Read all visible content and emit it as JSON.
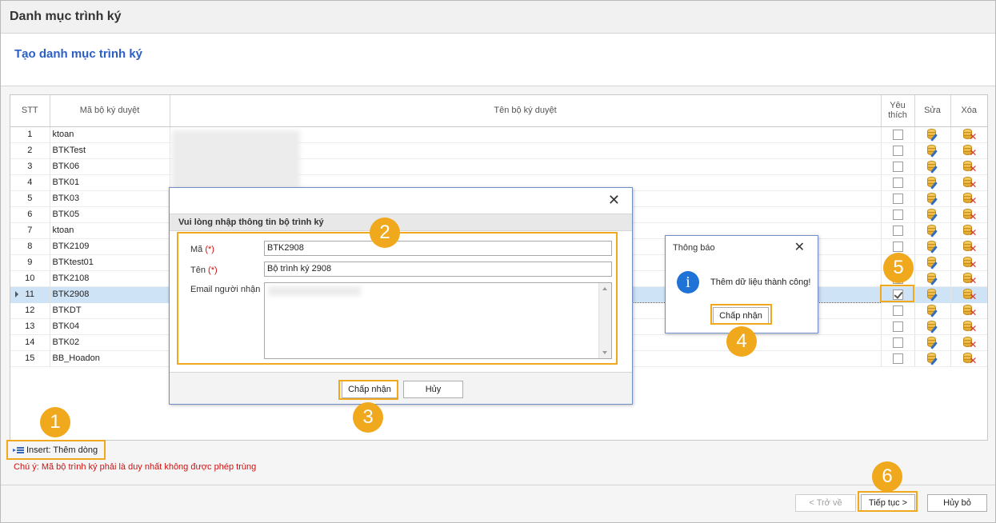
{
  "window": {
    "title": "Danh mục trình ký"
  },
  "section": {
    "subtitle": "Tạo danh mục trình ký"
  },
  "grid": {
    "headers": {
      "stt": "STT",
      "code": "Mã bộ ký duyệt",
      "name": "Tên bộ ký duyệt",
      "fav": "Yêu thích",
      "edit": "Sửa",
      "del": "Xóa"
    },
    "rows": [
      {
        "stt": "1",
        "code": "ktoan",
        "fav": false
      },
      {
        "stt": "2",
        "code": "BTKTest",
        "fav": false
      },
      {
        "stt": "3",
        "code": "BTK06",
        "fav": false
      },
      {
        "stt": "4",
        "code": "BTK01",
        "fav": false
      },
      {
        "stt": "5",
        "code": "BTK03",
        "fav": false
      },
      {
        "stt": "6",
        "code": "BTK05",
        "fav": false
      },
      {
        "stt": "7",
        "code": "ktoan",
        "fav": false
      },
      {
        "stt": "8",
        "code": "BTK2109",
        "fav": false
      },
      {
        "stt": "9",
        "code": "BTKtest01",
        "fav": false
      },
      {
        "stt": "10",
        "code": "BTK2108",
        "fav": false
      },
      {
        "stt": "11",
        "code": "BTK2908",
        "fav": true,
        "selected": true
      },
      {
        "stt": "12",
        "code": "BTKDT",
        "fav": false
      },
      {
        "stt": "13",
        "code": "BTK04",
        "fav": false
      },
      {
        "stt": "14",
        "code": "BTK02",
        "fav": false
      },
      {
        "stt": "15",
        "code": "BB_Hoadon",
        "fav": false
      }
    ]
  },
  "insert_button": {
    "label": "Insert: Thêm dòng"
  },
  "note": "Chú ý: Mã bộ trình ký phải là duy nhất không được phép trùng",
  "footer": {
    "back": "< Trở về",
    "next": "Tiếp tục >",
    "cancel": "Hủy bỏ"
  },
  "dialog": {
    "header": "Vui lòng nhập thông tin bộ trình ký",
    "code_label": "Mã",
    "name_label": "Tên",
    "required_mark": "(*)",
    "email_label": "Email người nhận",
    "code_value": "BTK2908",
    "name_value": "Bộ trình ký 2908",
    "ok": "Chấp nhận",
    "cancel": "Hủy"
  },
  "message": {
    "title": "Thông báo",
    "text": "Thêm dữ liệu thành công!",
    "ok": "Chấp nhận"
  },
  "steps": [
    "1",
    "2",
    "3",
    "4",
    "5",
    "6"
  ],
  "colors": {
    "accent": "#f0a81c",
    "title_blue": "#2b5fc7",
    "note_red": "#d01010",
    "selected_row": "#cfe3f7"
  }
}
